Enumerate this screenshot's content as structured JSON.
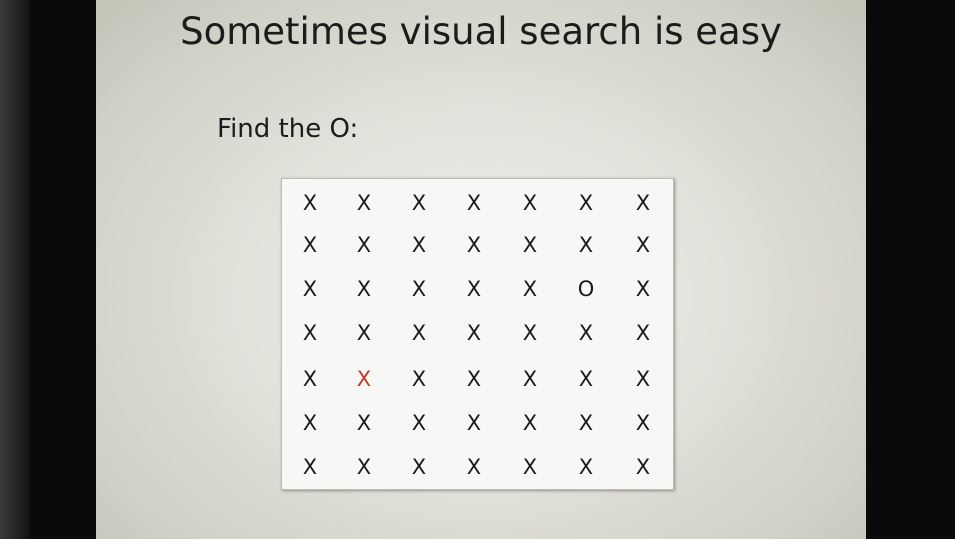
{
  "slide": {
    "title": "Sometimes visual search is easy",
    "prompt": "Find the O:"
  },
  "grid": {
    "rows": [
      [
        "X",
        "X",
        "X",
        "X",
        "X",
        "X",
        "X"
      ],
      [
        "X",
        "X",
        "X",
        "X",
        "X",
        "X",
        "X"
      ],
      [
        "X",
        "X",
        "X",
        "X",
        "X",
        "O",
        "X"
      ],
      [
        "X",
        "X",
        "X",
        "X",
        "X",
        "X",
        "X"
      ],
      [
        "X",
        "X",
        "X",
        "X",
        "X",
        "X",
        "X"
      ],
      [
        "X",
        "X",
        "X",
        "X",
        "X",
        "X",
        "X"
      ],
      [
        "X",
        "X",
        "X",
        "X",
        "X",
        "X",
        "X"
      ]
    ],
    "highlight": {
      "row": 4,
      "col": 1,
      "color": "#c0392b"
    }
  }
}
